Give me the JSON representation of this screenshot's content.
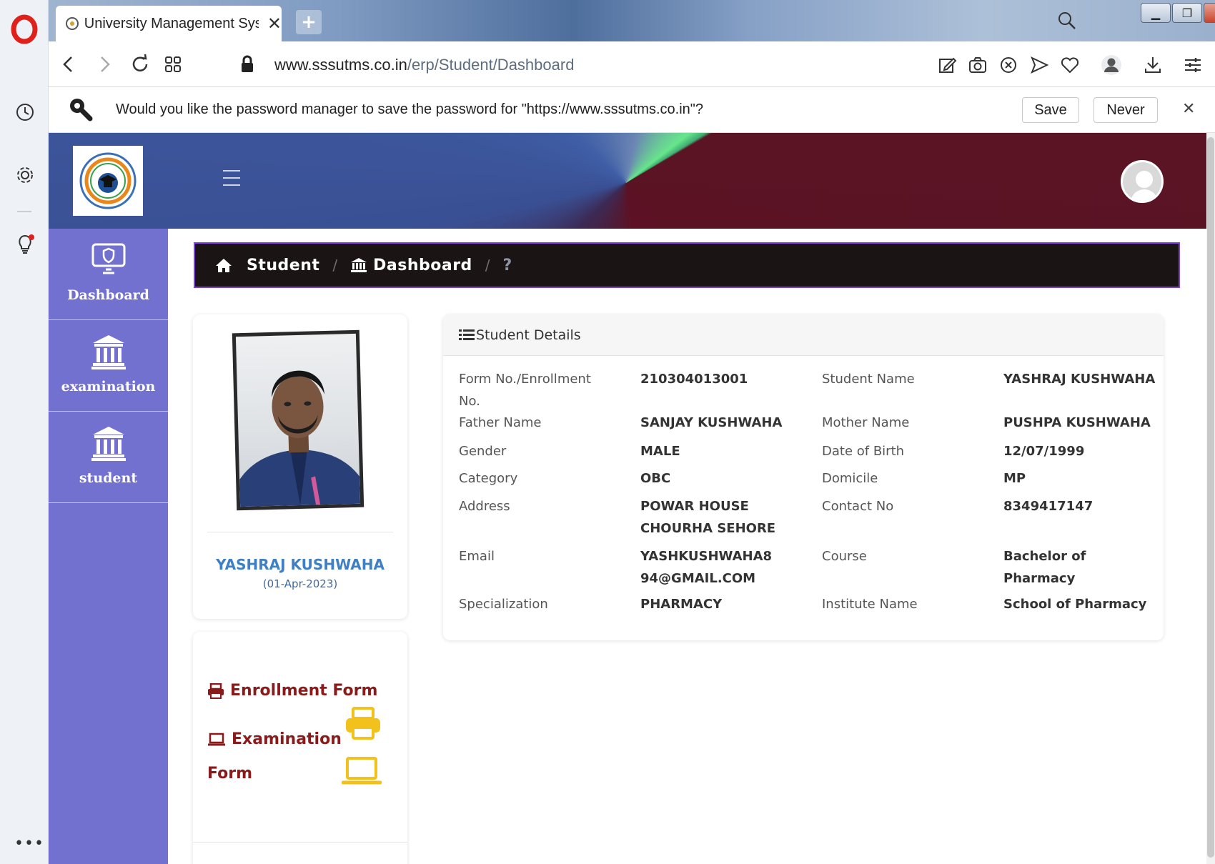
{
  "browser": {
    "tab_title": "University Management Sys",
    "url_host": "www.sssutms.co.in",
    "url_path": "/erp/Student/Dashboard",
    "password_prompt": "Would you like the password manager to save the password for \"https://www.sssutms.co.in\"?",
    "save_label": "Save",
    "never_label": "Never"
  },
  "sidebar": {
    "items": [
      {
        "label": "Dashboard",
        "icon": "monitor-shield-icon"
      },
      {
        "label": "examination",
        "icon": "institution-icon"
      },
      {
        "label": "student",
        "icon": "institution-icon"
      }
    ]
  },
  "breadcrumb": {
    "items": [
      "Student",
      "Dashboard"
    ],
    "help": "?"
  },
  "profile": {
    "name": "YASHRAJ KUSHWAHA",
    "date": "(01-Apr-2023)"
  },
  "forms": {
    "enrollment_label": "Enrollment Form",
    "examination_label_1": "Examination",
    "examination_label_2": "Form"
  },
  "details": {
    "title": "Student Details",
    "rows": [
      {
        "l1": "Form No./Enrollment No.",
        "v1": "210304013001",
        "l2": "Student Name",
        "v2": "YASHRAJ KUSHWAHA"
      },
      {
        "l1": "Father Name",
        "v1": "SANJAY KUSHWAHA",
        "l2": "Mother Name",
        "v2": "PUSHPA KUSHWAHA"
      },
      {
        "l1": "Gender",
        "v1": "MALE",
        "l2": "Date of Birth",
        "v2": "12/07/1999"
      },
      {
        "l1": "Category",
        "v1": "OBC",
        "l2": "Domicile",
        "v2": "MP"
      },
      {
        "l1": "Address",
        "v1": "POWAR HOUSE CHOURHA SEHORE",
        "l2": "Contact No",
        "v2": "8349417147"
      },
      {
        "l1": "Email",
        "v1": "YASHKUSHWAHA894@GMAIL.COM",
        "l2": "Course",
        "v2": "Bachelor of Pharmacy"
      },
      {
        "l1": "Specialization",
        "v1": "PHARMACY",
        "l2": "Institute Name",
        "v2": "School of Pharmacy"
      }
    ]
  },
  "colors": {
    "sidebar": "#7371cf",
    "breadcrumb_bg": "#1b1414",
    "breadcrumb_border": "#7b3fe4",
    "link_red": "#8b1a1a",
    "icon_yellow": "#f2c11c",
    "name_blue": "#3f7fc4"
  }
}
